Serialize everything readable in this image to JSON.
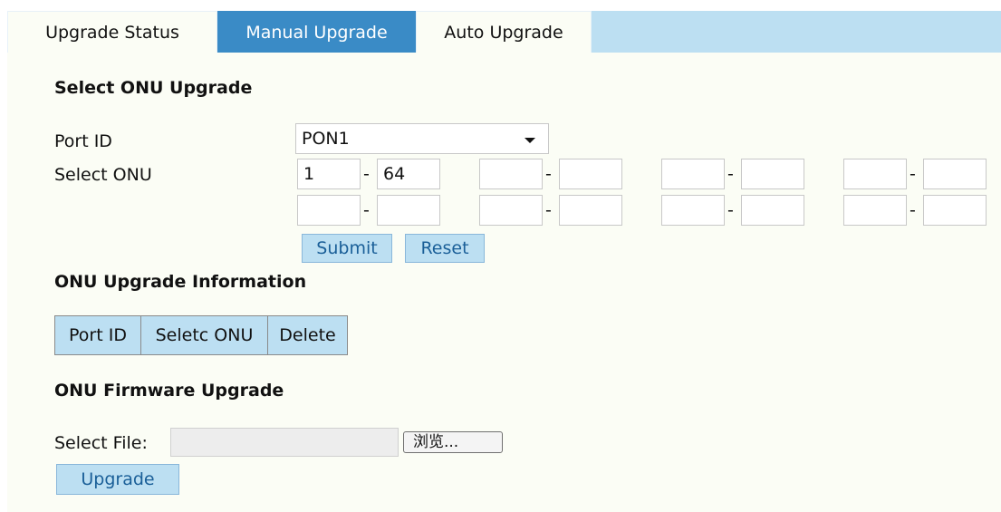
{
  "tabs": [
    {
      "label": "Upgrade Status",
      "active": false
    },
    {
      "label": "Manual Upgrade",
      "active": true
    },
    {
      "label": "Auto Upgrade",
      "active": false
    }
  ],
  "select_section": {
    "heading": "Select ONU Upgrade",
    "port_label": "Port ID",
    "port_value": "PON1",
    "onu_label": "Select ONU",
    "dash": "-",
    "ranges": [
      {
        "from": "1",
        "to": "64"
      },
      {
        "from": "",
        "to": ""
      },
      {
        "from": "",
        "to": ""
      },
      {
        "from": "",
        "to": ""
      },
      {
        "from": "",
        "to": ""
      },
      {
        "from": "",
        "to": ""
      },
      {
        "from": "",
        "to": ""
      },
      {
        "from": "",
        "to": ""
      }
    ],
    "submit_label": "Submit",
    "reset_label": "Reset"
  },
  "info_section": {
    "heading": "ONU Upgrade Information",
    "columns": [
      "Port ID",
      "Seletc ONU",
      "Delete"
    ]
  },
  "firmware_section": {
    "heading": "ONU Firmware Upgrade",
    "file_label": "Select File:",
    "file_value": "",
    "browse_label": "浏览...",
    "upgrade_label": "Upgrade"
  },
  "colors": {
    "tabbar": "#bcdff2",
    "active_tab": "#3a8bc6",
    "panel": "#fbfdf5",
    "button_bg": "#bcdff2",
    "button_text": "#1a5f98"
  }
}
